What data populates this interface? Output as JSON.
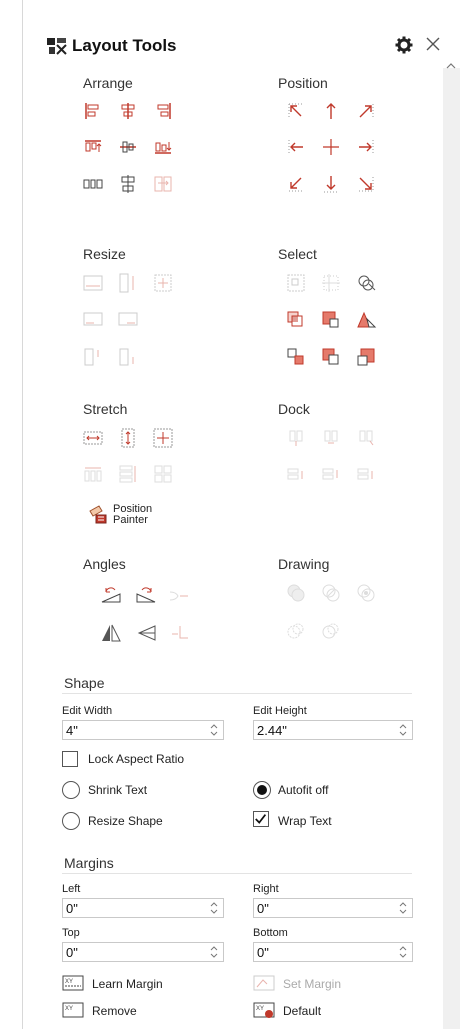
{
  "header": {
    "title": "Layout Tools"
  },
  "groups": {
    "arrange": "Arrange",
    "position": "Position",
    "resize": "Resize",
    "select": "Select",
    "stretch": "Stretch",
    "dock": "Dock",
    "angles": "Angles",
    "drawing": "Drawing"
  },
  "position_painter": {
    "line1": "Position",
    "line2": "Painter"
  },
  "shape": {
    "title": "Shape",
    "edit_width_label": "Edit Width",
    "edit_width_value": "4\"",
    "edit_height_label": "Edit Height",
    "edit_height_value": "2.44\"",
    "lock_aspect": "Lock Aspect Ratio",
    "shrink_text": "Shrink Text",
    "autofit_off": "Autofit off",
    "resize_shape": "Resize Shape",
    "wrap_text": "Wrap Text"
  },
  "margins": {
    "title": "Margins",
    "left_label": "Left",
    "left_value": "0\"",
    "right_label": "Right",
    "right_value": "0\"",
    "top_label": "Top",
    "top_value": "0\"",
    "bottom_label": "Bottom",
    "bottom_value": "0\"",
    "learn_margin": "Learn Margin",
    "set_margin": "Set Margin",
    "remove": "Remove",
    "default": "Default"
  },
  "colors": {
    "accent": "#c0392b",
    "disabled": "#e9b4ae"
  }
}
